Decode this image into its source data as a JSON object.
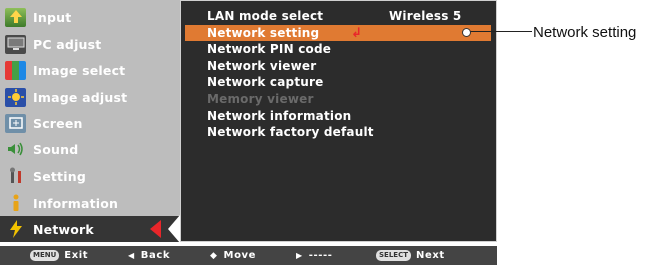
{
  "sidebar": {
    "items": [
      {
        "label": "Input",
        "icon": "input-icon"
      },
      {
        "label": "PC adjust",
        "icon": "pc-adjust-icon"
      },
      {
        "label": "Image select",
        "icon": "image-select-icon"
      },
      {
        "label": "Image adjust",
        "icon": "image-adjust-icon"
      },
      {
        "label": "Screen",
        "icon": "screen-icon"
      },
      {
        "label": "Sound",
        "icon": "sound-icon"
      },
      {
        "label": "Setting",
        "icon": "setting-icon"
      },
      {
        "label": "Information",
        "icon": "information-icon"
      },
      {
        "label": "Network",
        "icon": "network-icon"
      }
    ],
    "selected": "Network"
  },
  "menu": {
    "rows": [
      {
        "label": "LAN mode select",
        "value": "Wireless 5"
      },
      {
        "label": "Network setting",
        "highlighted": true
      },
      {
        "label": "Network PIN code"
      },
      {
        "label": "Network viewer"
      },
      {
        "label": "Network capture"
      },
      {
        "label": "Memory viewer",
        "disabled": true
      },
      {
        "label": "Network information"
      },
      {
        "label": "Network factory default"
      }
    ],
    "colors": {
      "highlight": "#e07a32",
      "panel": "#2c2c2c",
      "sidebar": "#bdbdbd"
    }
  },
  "bottom_bar": {
    "menu_key": "MENU",
    "exit": "Exit",
    "back_arrow": "◀",
    "back": "Back",
    "move_arrow": "◆",
    "move": "Move",
    "next_arrow": "▶",
    "dashes": "-----",
    "select_key": "SELECT",
    "next": "Next"
  },
  "callout": {
    "text": "Network setting"
  }
}
